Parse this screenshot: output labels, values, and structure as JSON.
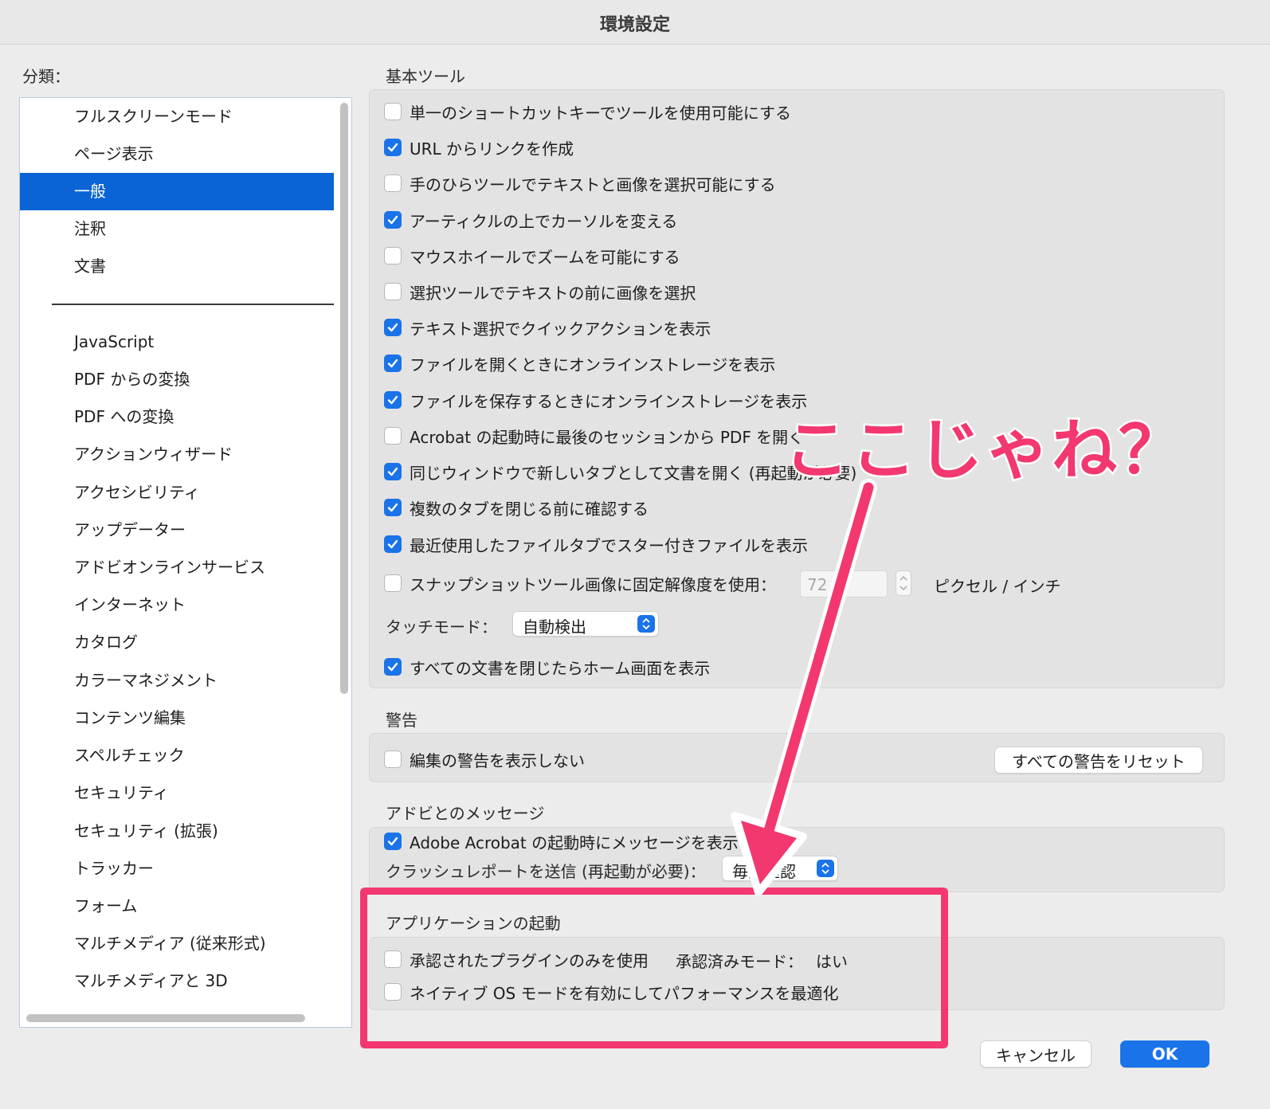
{
  "window": {
    "title": "環境設定"
  },
  "categories": {
    "label": "分類：",
    "items_top": [
      "フルスクリーンモード",
      "ページ表示",
      "一般",
      "注釈",
      "文書"
    ],
    "selected": "一般",
    "items": [
      "JavaScript",
      "PDF からの変換",
      "PDF への変換",
      "アクションウィザード",
      "アクセシビリティ",
      "アップデーター",
      "アドビオンラインサービス",
      "インターネット",
      "カタログ",
      "カラーマネジメント",
      "コンテンツ編集",
      "スペルチェック",
      "セキュリティ",
      "セキュリティ (拡張)",
      "トラッカー",
      "フォーム",
      "マルチメディア (従来形式)",
      "マルチメディアと 3D"
    ]
  },
  "basic_tools": {
    "title": "基本ツール",
    "options": [
      {
        "label": "単一のショートカットキーでツールを使用可能にする",
        "checked": false
      },
      {
        "label": "URL からリンクを作成",
        "checked": true
      },
      {
        "label": "手のひらツールでテキストと画像を選択可能にする",
        "checked": false
      },
      {
        "label": "アーティクルの上でカーソルを変える",
        "checked": true
      },
      {
        "label": "マウスホイールでズームを可能にする",
        "checked": false
      },
      {
        "label": "選択ツールでテキストの前に画像を選択",
        "checked": false
      },
      {
        "label": "テキスト選択でクイックアクションを表示",
        "checked": true
      },
      {
        "label": "ファイルを開くときにオンラインストレージを表示",
        "checked": true
      },
      {
        "label": "ファイルを保存するときにオンラインストレージを表示",
        "checked": true
      },
      {
        "label": "Acrobat の起動時に最後のセッションから PDF を開く",
        "checked": false
      },
      {
        "label": "同じウィンドウで新しいタブとして文書を開く (再起動が必要)",
        "checked": true
      },
      {
        "label": "複数のタブを閉じる前に確認する",
        "checked": true
      },
      {
        "label": "最近使用したファイルタブでスター付きファイルを表示",
        "checked": true
      }
    ],
    "snapshot": {
      "label": "スナップショットツール画像に固定解像度を使用：",
      "checked": false,
      "value": "72",
      "unit": "ピクセル / インチ"
    },
    "touch_mode": {
      "label": "タッチモード：",
      "value": "自動検出"
    },
    "home_screen": {
      "label": "すべての文書を閉じたらホーム画面を表示",
      "checked": true
    }
  },
  "warnings": {
    "title": "警告",
    "option": {
      "label": "編集の警告を表示しない",
      "checked": false
    },
    "reset_button": "すべての警告をリセット"
  },
  "adobe_messages": {
    "title": "アドビとのメッセージ",
    "option": {
      "label": "Adobe Acrobat の起動時にメッセージを表示",
      "checked": true
    },
    "crash_report": {
      "label": "クラッシュレポートを送信 (再起動が必要)：",
      "value": "毎回確認"
    }
  },
  "app_startup": {
    "title": "アプリケーションの起動",
    "plugins": {
      "label": "承認されたプラグインのみを使用",
      "checked": false
    },
    "approved_mode": {
      "label": "承認済みモード：",
      "value": "はい"
    },
    "native_os": {
      "label": "ネイティブ OS モードを有効にしてパフォーマンスを最適化",
      "checked": false
    }
  },
  "footer": {
    "cancel": "キャンセル",
    "ok": "OK"
  },
  "annotation": {
    "text": "ここじゃね？",
    "color": "#f2386f"
  },
  "colors": {
    "accent": "#1a73e8",
    "selection": "#0a64d6",
    "annotation": "#f2386f"
  }
}
